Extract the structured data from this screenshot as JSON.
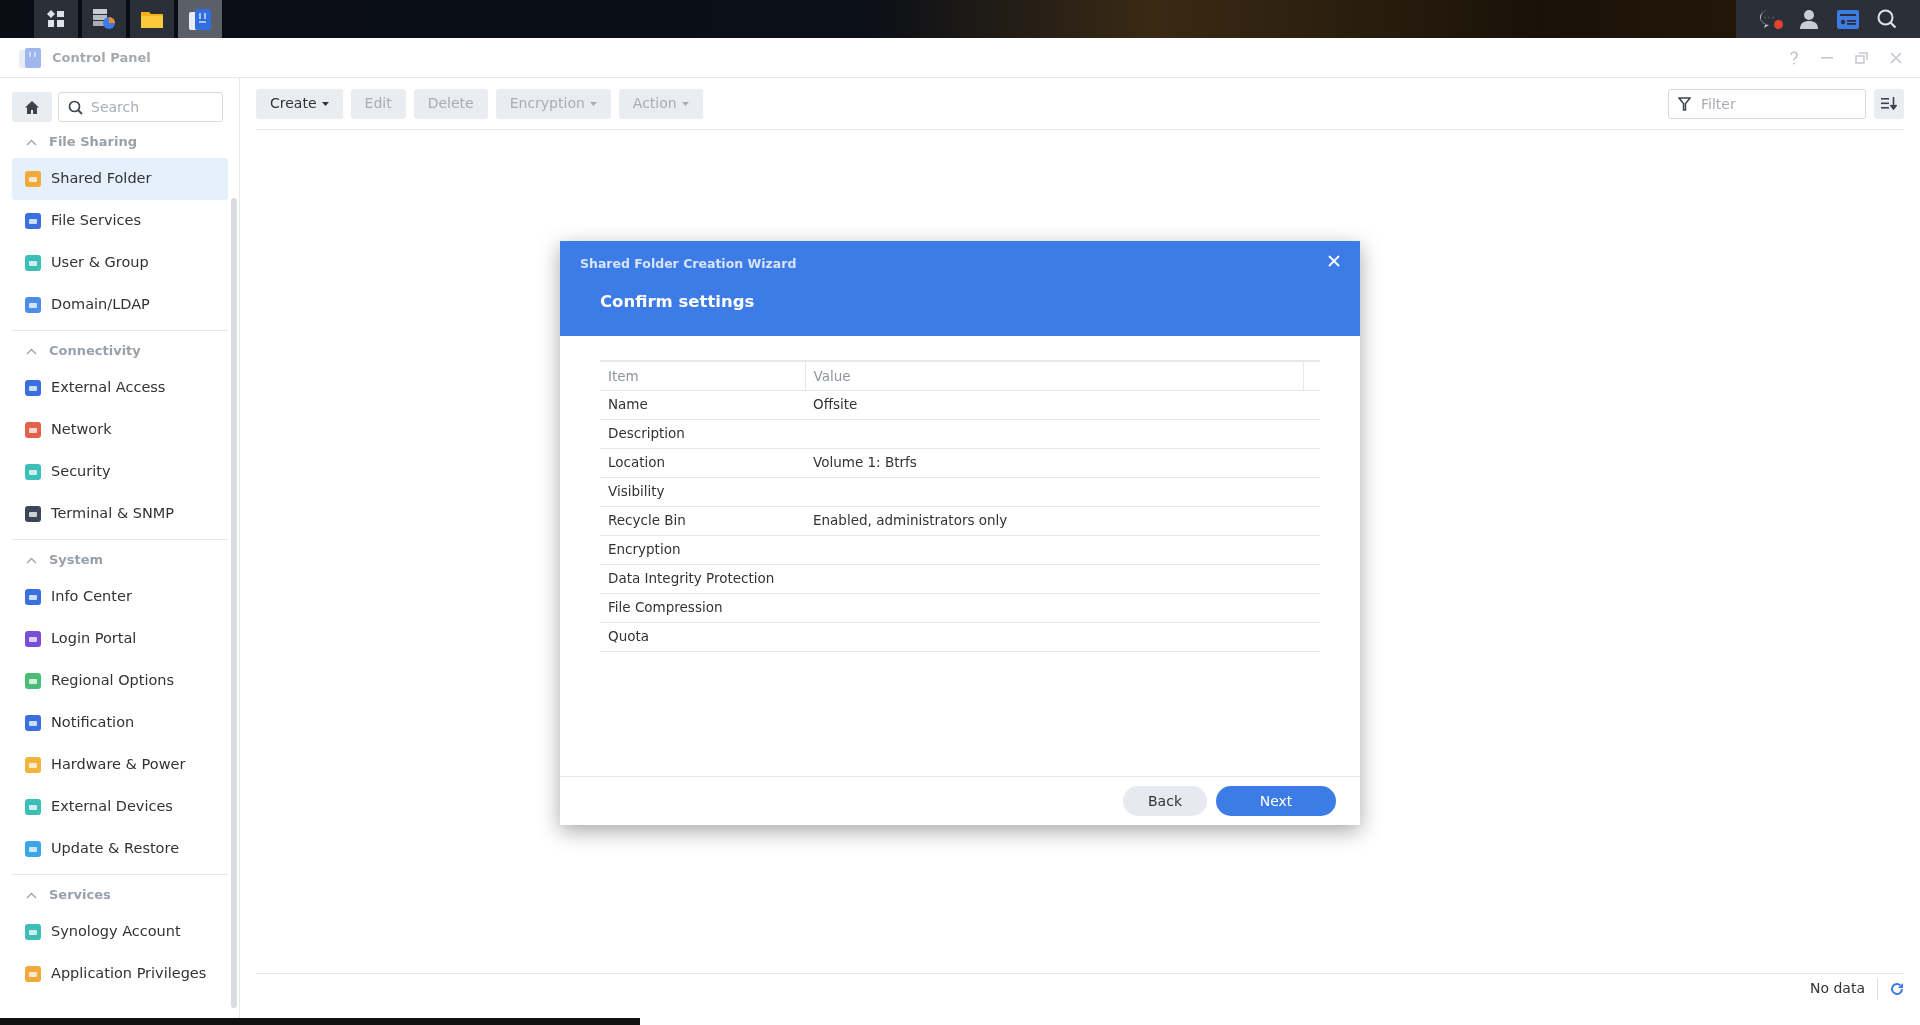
{
  "taskbar": {
    "apps": [
      {
        "selected": false
      },
      {
        "selected": false
      },
      {
        "selected": true
      }
    ],
    "notification_badge": true
  },
  "window": {
    "title": "Control Panel"
  },
  "sidebar": {
    "search": {
      "placeholder": "Search"
    },
    "groups": [
      {
        "label": "File Sharing",
        "expanded": true,
        "items": [
          {
            "label": "Shared Folder",
            "selected": true
          },
          {
            "label": "File Services",
            "selected": false
          },
          {
            "label": "User & Group",
            "selected": false
          },
          {
            "label": "Domain/LDAP",
            "selected": false
          }
        ]
      },
      {
        "label": "Connectivity",
        "expanded": true,
        "items": [
          {
            "label": "External Access",
            "selected": false
          },
          {
            "label": "Network",
            "selected": false
          },
          {
            "label": "Security",
            "selected": false
          },
          {
            "label": "Terminal & SNMP",
            "selected": false
          }
        ]
      },
      {
        "label": "System",
        "expanded": true,
        "items": [
          {
            "label": "Info Center",
            "selected": false
          },
          {
            "label": "Login Portal",
            "selected": false
          },
          {
            "label": "Regional Options",
            "selected": false
          },
          {
            "label": "Notification",
            "selected": false
          },
          {
            "label": "Hardware & Power",
            "selected": false
          },
          {
            "label": "External Devices",
            "selected": false
          },
          {
            "label": "Update & Restore",
            "selected": false
          }
        ]
      },
      {
        "label": "Services",
        "expanded": true,
        "items": [
          {
            "label": "Synology Account",
            "selected": false
          },
          {
            "label": "Application Privileges",
            "selected": false
          }
        ]
      }
    ]
  },
  "toolbar": {
    "buttons": [
      {
        "label": "Create",
        "dropdown": true,
        "disabled": false
      },
      {
        "label": "Edit",
        "dropdown": false,
        "disabled": true
      },
      {
        "label": "Delete",
        "dropdown": false,
        "disabled": true
      },
      {
        "label": "Encryption",
        "dropdown": true,
        "disabled": true
      },
      {
        "label": "Action",
        "dropdown": true,
        "disabled": true
      }
    ],
    "filter": {
      "placeholder": "Filter"
    }
  },
  "status_bar": {
    "text": "No data"
  },
  "dialog": {
    "title": "Shared Folder Creation Wizard",
    "heading": "Confirm settings",
    "table": {
      "columns": [
        "Item",
        "Value"
      ],
      "rows": [
        [
          "Name",
          "Offsite"
        ],
        [
          "Description",
          ""
        ],
        [
          "Location",
          "Volume 1: Btrfs"
        ],
        [
          "Visibility",
          ""
        ],
        [
          "Recycle Bin",
          "Enabled, administrators only"
        ],
        [
          "Encryption",
          ""
        ],
        [
          "Data Integrity Protection",
          ""
        ],
        [
          "File Compression",
          ""
        ],
        [
          "Quota",
          ""
        ]
      ]
    },
    "buttons": [
      {
        "label": "Back",
        "kind": "secondary"
      },
      {
        "label": "Next",
        "kind": "primary"
      }
    ]
  }
}
